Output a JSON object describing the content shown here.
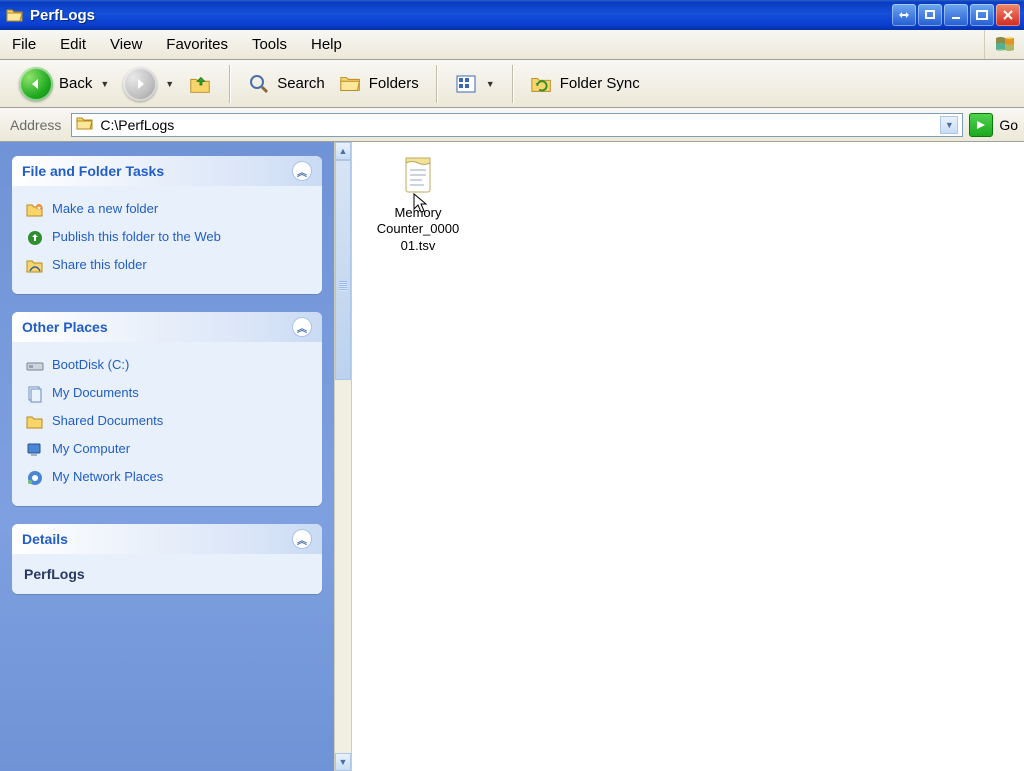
{
  "window": {
    "title": "PerfLogs"
  },
  "menu": {
    "file": "File",
    "edit": "Edit",
    "view": "View",
    "favorites": "Favorites",
    "tools": "Tools",
    "help": "Help"
  },
  "toolbar": {
    "back": "Back",
    "search": "Search",
    "folders": "Folders",
    "folder_sync": "Folder Sync"
  },
  "address": {
    "label": "Address",
    "path": "C:\\PerfLogs",
    "go": "Go"
  },
  "tasks": {
    "file_folder": {
      "title": "File and Folder Tasks",
      "make_folder": "Make a new folder",
      "publish": "Publish this folder to the Web",
      "share": "Share this folder"
    },
    "other_places": {
      "title": "Other Places",
      "bootdisk": "BootDisk (C:)",
      "my_documents": "My Documents",
      "shared_documents": "Shared Documents",
      "my_computer": "My Computer",
      "my_network": "My Network Places"
    },
    "details": {
      "title": "Details",
      "folder_name": "PerfLogs"
    }
  },
  "content": {
    "file_name": "Memory Counter_000001.tsv",
    "file_name_line1": "Memory",
    "file_name_line2": "Counter_0000",
    "file_name_line3": "01.tsv"
  }
}
